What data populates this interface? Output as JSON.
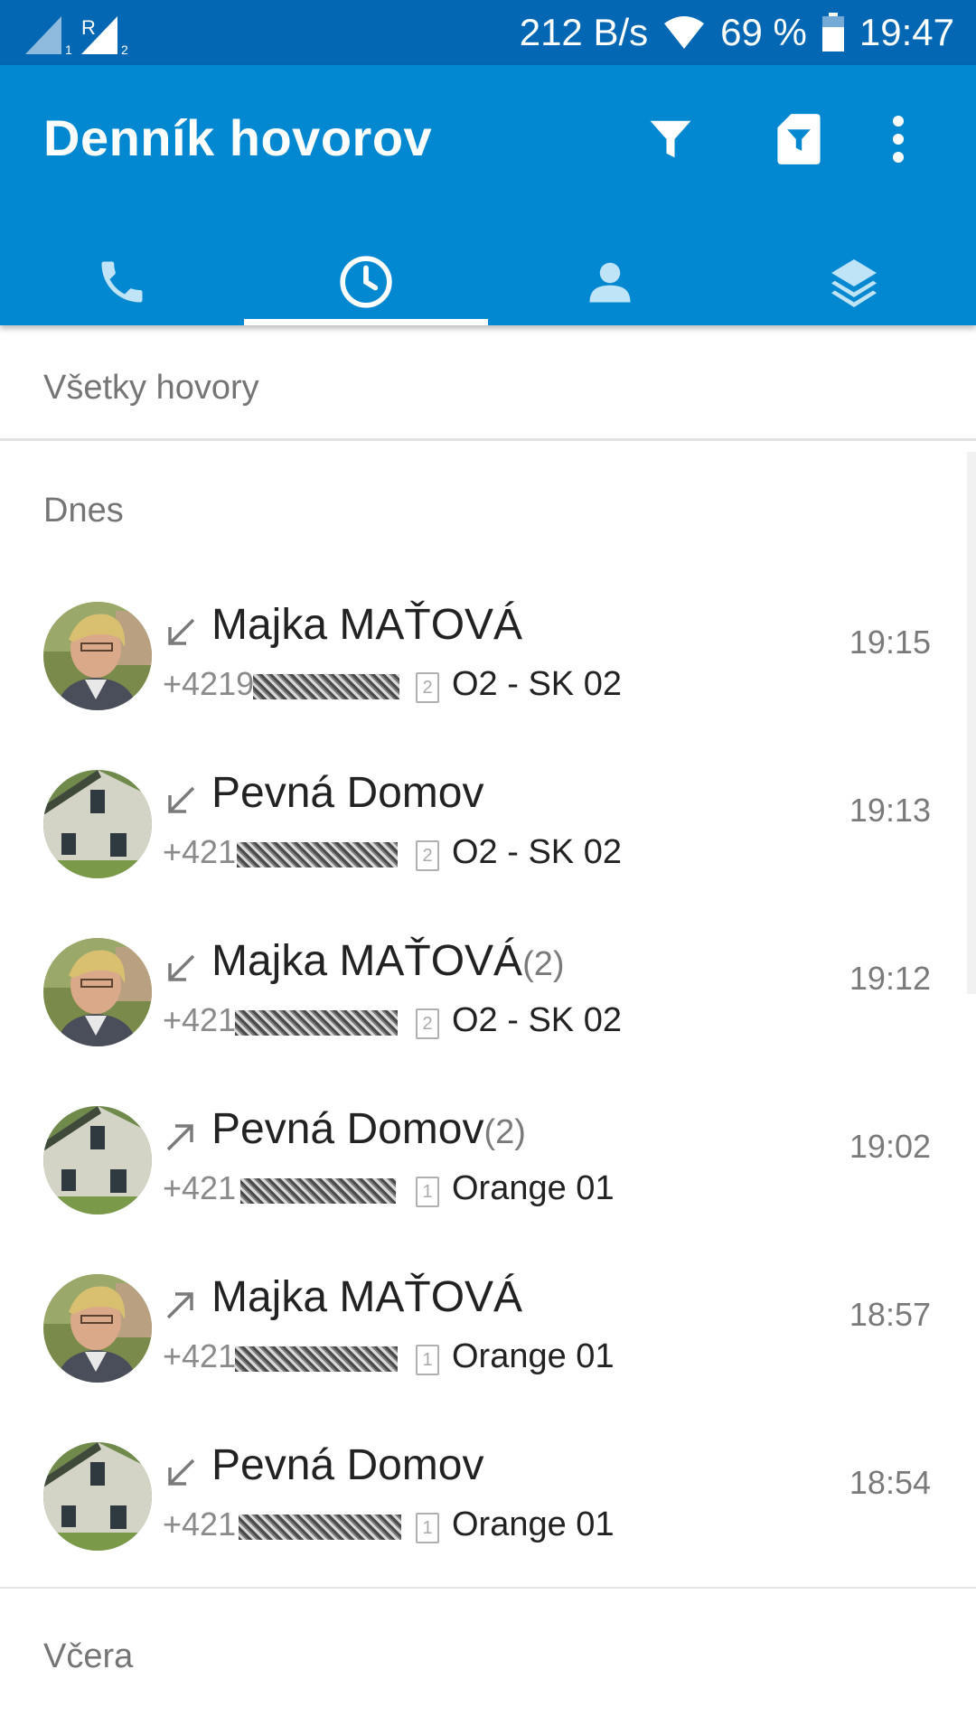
{
  "status_bar": {
    "sim1": "1",
    "roaming": "R",
    "sim2": "2",
    "speed": "212 B/s",
    "battery": "69 %",
    "time": "19:47"
  },
  "app_bar": {
    "title": "Denník hovorov",
    "actions": [
      "filter-icon",
      "sim-filter-icon",
      "more-vert-icon"
    ]
  },
  "tabs": [
    {
      "icon": "phone-icon",
      "active": false
    },
    {
      "icon": "clock-icon",
      "active": true
    },
    {
      "icon": "person-icon",
      "active": false
    },
    {
      "icon": "layers-icon",
      "active": false
    }
  ],
  "filter": {
    "label": "Všetky hovory"
  },
  "sections": {
    "today": "Dnes",
    "yesterday": "Včera"
  },
  "calls": [
    {
      "name": "Majka MAŤOVÁ",
      "count": "",
      "direction": "incoming",
      "number_prefix": "+4219",
      "sim": "2",
      "carrier": "O2 - SK 02",
      "time": "19:15",
      "avatar": "woman-photo"
    },
    {
      "name": "Pevná Domov",
      "count": "",
      "direction": "incoming",
      "number_prefix": "+421",
      "sim": "2",
      "carrier": "O2 - SK 02",
      "time": "19:13",
      "avatar": "house-photo"
    },
    {
      "name": "Majka MAŤOVÁ",
      "count": "(2)",
      "direction": "incoming",
      "number_prefix": "+421",
      "sim": "2",
      "carrier": "O2 - SK 02",
      "time": "19:12",
      "avatar": "woman-photo"
    },
    {
      "name": "Pevná Domov",
      "count": "(2)",
      "direction": "outgoing",
      "number_prefix": "+421",
      "sim": "1",
      "carrier": "Orange 01",
      "time": "19:02",
      "avatar": "house-photo"
    },
    {
      "name": "Majka MAŤOVÁ",
      "count": "",
      "direction": "outgoing",
      "number_prefix": "+421",
      "sim": "1",
      "carrier": "Orange 01",
      "time": "18:57",
      "avatar": "woman-photo"
    },
    {
      "name": "Pevná Domov",
      "count": "",
      "direction": "incoming",
      "number_prefix": "+421",
      "sim": "1",
      "carrier": "Orange 01",
      "time": "18:54",
      "avatar": "house-photo"
    }
  ],
  "colors": {
    "statusbar": "#0367b4",
    "appbar": "#0288d1",
    "tab_icon_active": "#ffffff",
    "tab_icon_inactive": "#bfe3f7"
  }
}
